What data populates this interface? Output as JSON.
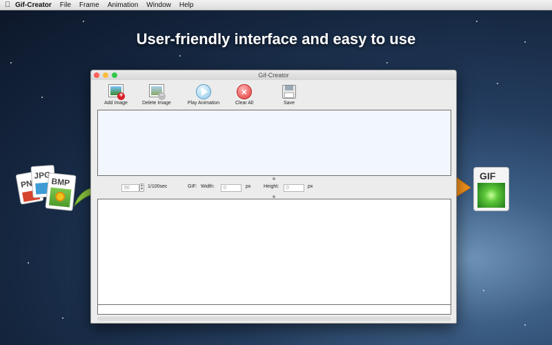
{
  "menubar": {
    "app_name": "Gif-Creator",
    "items": [
      "File",
      "Frame",
      "Animation",
      "Window",
      "Help"
    ]
  },
  "headline": "User-friendly interface and easy to use",
  "window": {
    "title": "Gif-Creator",
    "toolbar": {
      "add_image": "Add Image",
      "delete_image": "Delete Image",
      "play_animation": "Play Animation",
      "clear_all": "Clear All",
      "save": "Save"
    },
    "controls": {
      "delay_value": "50",
      "delay_unit": "1/100sec",
      "gif_label": "GIF:",
      "width_label": "Width:",
      "width_value": "0",
      "width_unit": "px",
      "height_label": "Height:",
      "height_value": "0",
      "height_unit": "px"
    }
  },
  "decor": {
    "file_png": "PN",
    "file_jpg": "JPG",
    "file_bmp": "BMP",
    "file_gif": "GIF"
  },
  "colors": {
    "close": "#fc605c",
    "minimize": "#fdbc40",
    "zoom": "#34c84a",
    "arrow_green": "#8cc63f",
    "arrow_orange": "#f7941d"
  }
}
